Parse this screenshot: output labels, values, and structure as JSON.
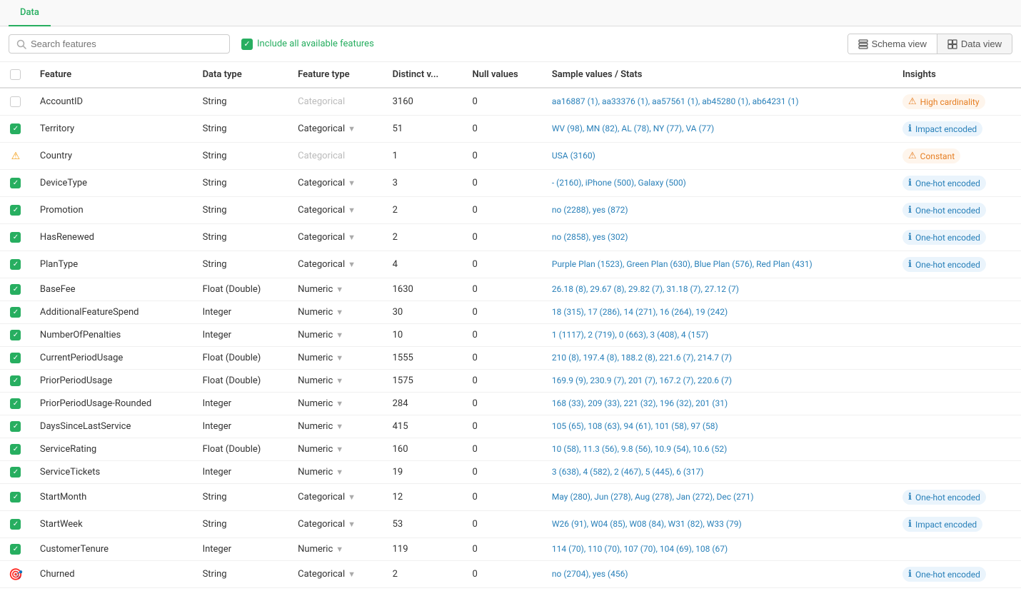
{
  "tabs": [
    {
      "label": "Data",
      "active": true
    }
  ],
  "toolbar": {
    "search_placeholder": "Search features",
    "include_label": "Include all available features",
    "schema_view_label": "Schema view",
    "data_view_label": "Data view"
  },
  "table": {
    "columns": [
      "",
      "Feature",
      "Data type",
      "Feature type",
      "Distinct v...",
      "Null values",
      "Sample values / Stats",
      "Insights"
    ],
    "rows": [
      {
        "check": "unchecked",
        "feature": "AccountID",
        "datatype": "String",
        "featuretype": "Categorical",
        "featuretype_disabled": true,
        "distinct": "3160",
        "null": "0",
        "sample": "aa16887 (1), aa33376 (1), aa57561 (1), ab45280 (1), ab64231 (1)",
        "insight_type": "orange",
        "insight_icon": "⚠",
        "insight_text": "High cardinality"
      },
      {
        "check": "checked",
        "feature": "Territory",
        "datatype": "String",
        "featuretype": "Categorical",
        "featuretype_disabled": false,
        "distinct": "51",
        "null": "0",
        "sample": "WV (98), MN (82), AL (78), NY (77), VA (77)",
        "insight_type": "blue",
        "insight_icon": "ℹ",
        "insight_text": "Impact encoded"
      },
      {
        "check": "warning",
        "feature": "Country",
        "datatype": "String",
        "featuretype": "Categorical",
        "featuretype_disabled": true,
        "distinct": "1",
        "null": "0",
        "sample": "USA (3160)",
        "insight_type": "orange",
        "insight_icon": "⚠",
        "insight_text": "Constant"
      },
      {
        "check": "checked",
        "feature": "DeviceType",
        "datatype": "String",
        "featuretype": "Categorical",
        "featuretype_disabled": false,
        "distinct": "3",
        "null": "0",
        "sample": "- (2160), iPhone (500), Galaxy (500)",
        "insight_type": "blue",
        "insight_icon": "ℹ",
        "insight_text": "One-hot encoded"
      },
      {
        "check": "checked",
        "feature": "Promotion",
        "datatype": "String",
        "featuretype": "Categorical",
        "featuretype_disabled": false,
        "distinct": "2",
        "null": "0",
        "sample": "no (2288), yes (872)",
        "insight_type": "blue",
        "insight_icon": "ℹ",
        "insight_text": "One-hot encoded"
      },
      {
        "check": "checked",
        "feature": "HasRenewed",
        "datatype": "String",
        "featuretype": "Categorical",
        "featuretype_disabled": false,
        "distinct": "2",
        "null": "0",
        "sample": "no (2858), yes (302)",
        "insight_type": "blue",
        "insight_icon": "ℹ",
        "insight_text": "One-hot encoded"
      },
      {
        "check": "checked",
        "feature": "PlanType",
        "datatype": "String",
        "featuretype": "Categorical",
        "featuretype_disabled": false,
        "distinct": "4",
        "null": "0",
        "sample": "Purple Plan (1523), Green Plan (630), Blue Plan (576), Red Plan (431)",
        "insight_type": "blue",
        "insight_icon": "ℹ",
        "insight_text": "One-hot encoded"
      },
      {
        "check": "checked",
        "feature": "BaseFee",
        "datatype": "Float (Double)",
        "featuretype": "Numeric",
        "featuretype_disabled": false,
        "distinct": "1630",
        "null": "0",
        "sample": "26.18 (8), 29.67 (8), 29.82 (7), 31.18 (7), 27.12 (7)",
        "insight_type": null,
        "insight_icon": "",
        "insight_text": ""
      },
      {
        "check": "checked",
        "feature": "AdditionalFeatureSpend",
        "datatype": "Integer",
        "featuretype": "Numeric",
        "featuretype_disabled": false,
        "distinct": "30",
        "null": "0",
        "sample": "18 (315), 17 (286), 14 (271), 16 (264), 19 (242)",
        "insight_type": null,
        "insight_icon": "",
        "insight_text": ""
      },
      {
        "check": "checked",
        "feature": "NumberOfPenalties",
        "datatype": "Integer",
        "featuretype": "Numeric",
        "featuretype_disabled": false,
        "distinct": "10",
        "null": "0",
        "sample": "1 (1117), 2 (719), 0 (663), 3 (408), 4 (157)",
        "insight_type": null,
        "insight_icon": "",
        "insight_text": ""
      },
      {
        "check": "checked",
        "feature": "CurrentPeriodUsage",
        "datatype": "Float (Double)",
        "featuretype": "Numeric",
        "featuretype_disabled": false,
        "distinct": "1555",
        "null": "0",
        "sample": "210 (8), 197.4 (8), 188.2 (8), 221.6 (7), 214.7 (7)",
        "insight_type": null,
        "insight_icon": "",
        "insight_text": ""
      },
      {
        "check": "checked",
        "feature": "PriorPeriodUsage",
        "datatype": "Float (Double)",
        "featuretype": "Numeric",
        "featuretype_disabled": false,
        "distinct": "1575",
        "null": "0",
        "sample": "169.9 (9), 230.9 (7), 201 (7), 167.2 (7), 220.6 (7)",
        "insight_type": null,
        "insight_icon": "",
        "insight_text": ""
      },
      {
        "check": "checked",
        "feature": "PriorPeriodUsage-Rounded",
        "datatype": "Integer",
        "featuretype": "Numeric",
        "featuretype_disabled": false,
        "distinct": "284",
        "null": "0",
        "sample": "168 (33), 209 (33), 221 (32), 196 (32), 201 (31)",
        "insight_type": null,
        "insight_icon": "",
        "insight_text": ""
      },
      {
        "check": "checked",
        "feature": "DaysSinceLastService",
        "datatype": "Integer",
        "featuretype": "Numeric",
        "featuretype_disabled": false,
        "distinct": "415",
        "null": "0",
        "sample": "105 (65), 108 (63), 94 (61), 101 (58), 97 (58)",
        "insight_type": null,
        "insight_icon": "",
        "insight_text": ""
      },
      {
        "check": "checked",
        "feature": "ServiceRating",
        "datatype": "Float (Double)",
        "featuretype": "Numeric",
        "featuretype_disabled": false,
        "distinct": "160",
        "null": "0",
        "sample": "10 (58), 11.3 (56), 9.8 (56), 10.9 (54), 10.6 (52)",
        "insight_type": null,
        "insight_icon": "",
        "insight_text": ""
      },
      {
        "check": "checked",
        "feature": "ServiceTickets",
        "datatype": "Integer",
        "featuretype": "Numeric",
        "featuretype_disabled": false,
        "distinct": "19",
        "null": "0",
        "sample": "3 (638), 4 (582), 2 (467), 5 (445), 6 (317)",
        "insight_type": null,
        "insight_icon": "",
        "insight_text": ""
      },
      {
        "check": "checked",
        "feature": "StartMonth",
        "datatype": "String",
        "featuretype": "Categorical",
        "featuretype_disabled": false,
        "distinct": "12",
        "null": "0",
        "sample": "May (280), Jun (278), Aug (278), Jan (272), Dec (271)",
        "insight_type": "blue",
        "insight_icon": "ℹ",
        "insight_text": "One-hot encoded"
      },
      {
        "check": "checked",
        "feature": "StartWeek",
        "datatype": "String",
        "featuretype": "Categorical",
        "featuretype_disabled": false,
        "distinct": "53",
        "null": "0",
        "sample": "W26 (91), W04 (85), W08 (84), W31 (82), W33 (79)",
        "insight_type": "blue",
        "insight_icon": "ℹ",
        "insight_text": "Impact encoded"
      },
      {
        "check": "checked",
        "feature": "CustomerTenure",
        "datatype": "Integer",
        "featuretype": "Numeric",
        "featuretype_disabled": false,
        "distinct": "119",
        "null": "0",
        "sample": "114 (70), 110 (70), 107 (70), 104 (69), 108 (67)",
        "insight_type": null,
        "insight_icon": "",
        "insight_text": ""
      },
      {
        "check": "target",
        "feature": "Churned",
        "datatype": "String",
        "featuretype": "Categorical",
        "featuretype_disabled": false,
        "distinct": "2",
        "null": "0",
        "sample": "no (2704), yes (456)",
        "insight_type": "blue",
        "insight_icon": "ℹ",
        "insight_text": "One-hot encoded"
      }
    ]
  }
}
